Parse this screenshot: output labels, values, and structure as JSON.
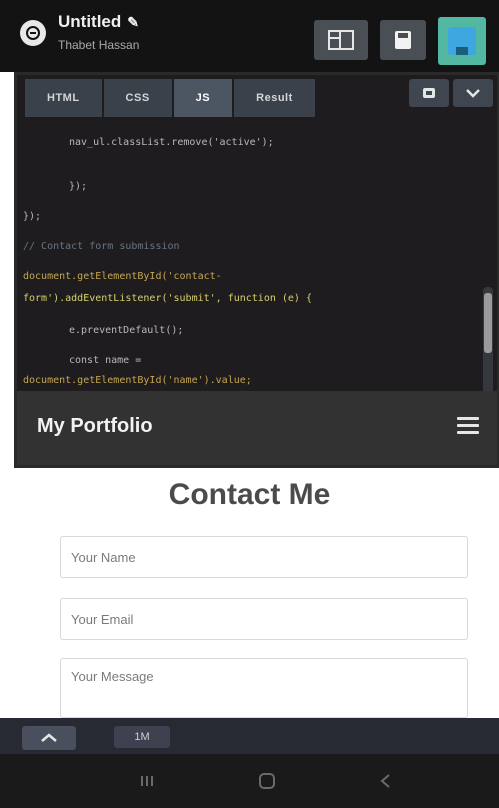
{
  "topbar": {
    "title": "Untitled",
    "subtitle": "Thabet Hassan",
    "icons": {
      "logo": "codepen-logo-icon",
      "edit": "pencil-icon",
      "layout": "layout-icon",
      "save": "save-icon",
      "user": "avatar"
    }
  },
  "editor": {
    "tabs": [
      "HTML",
      "CSS",
      "JS",
      "Result"
    ],
    "active_tab": "JS",
    "code_lines": [
      {
        "text": "    nav_ul.classList.remove('active');",
        "indent": 46
      },
      {
        "text": "  });",
        "indent": 46
      },
      {
        "text": "});",
        "indent": 0
      },
      {
        "text": "// Contact form submission",
        "indent": 0
      },
      {
        "text": "document.getElementById('contact-",
        "indent": 0
      },
      {
        "text": "form').addEventListener('submit', function (e) {",
        "indent": 0
      },
      {
        "text": "  e.preventDefault();",
        "indent": 46
      },
      {
        "text": "  const name =",
        "indent": 46
      },
      {
        "text": "document.getElementById('name').value;",
        "indent": 0
      }
    ]
  },
  "preview": {
    "brand": "My Portfolio",
    "contact_title": "Contact Me",
    "fields": {
      "name_placeholder": "Your Name",
      "email_placeholder": "Your Email",
      "message_placeholder": "Your Message"
    }
  },
  "bottombar": {
    "badge_label": "1M"
  },
  "colors": {
    "topbar_bg": "#131313",
    "editor_bg": "#1e1c1f",
    "tab_bg": "#3a414b",
    "nav_bg": "#323232",
    "avatar_bg": "#53b8a2"
  }
}
